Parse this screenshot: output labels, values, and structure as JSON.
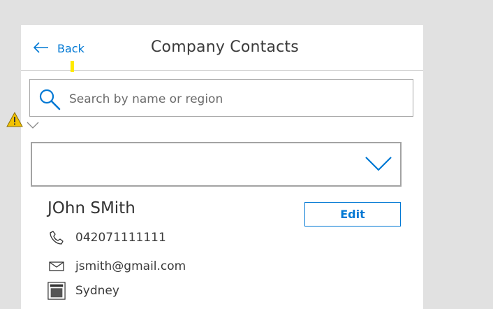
{
  "header": {
    "back_label": "Back",
    "title": "Company Contacts"
  },
  "search": {
    "placeholder": "Search by name or region",
    "value": ""
  },
  "filter_dropdown": {
    "selected": ""
  },
  "contact": {
    "name": "JOhn SMith",
    "edit_label": "Edit",
    "phone": "042071111111",
    "email": "jsmith@gmail.com",
    "region": "Sydney"
  },
  "colors": {
    "accent": "#0078d4",
    "background": "#e1e1e1",
    "card": "#ffffff",
    "warning": "#f2c200"
  },
  "icons": [
    "back-arrow-icon",
    "search-icon",
    "warning-icon",
    "caret-down-icon",
    "chevron-down-icon",
    "phone-icon",
    "mail-icon",
    "location-icon"
  ]
}
